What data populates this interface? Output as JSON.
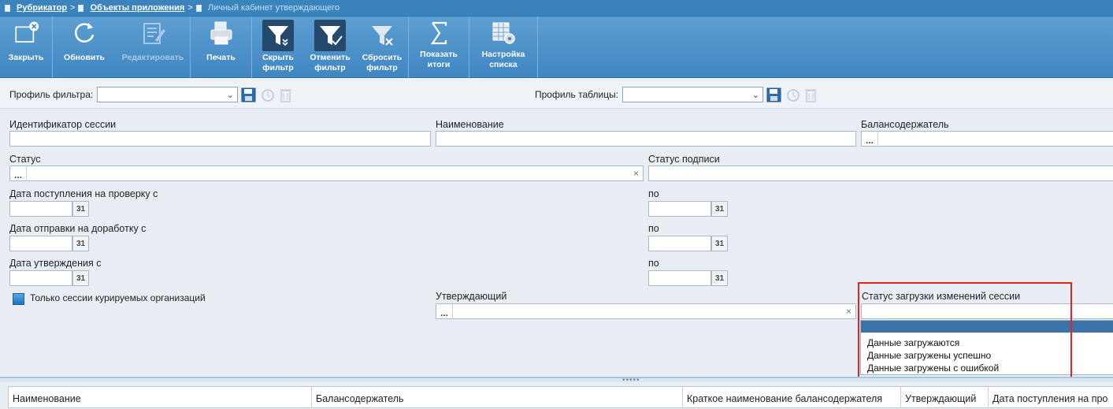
{
  "breadcrumb": {
    "items": [
      "Рубрикатор",
      "Объекты приложения"
    ],
    "separator": ">",
    "current": "Личный кабинет утверждающего"
  },
  "toolbar": {
    "close": "Закрыть",
    "refresh": "Обновить",
    "edit": "Редактировать",
    "print": "Печать",
    "hide_filter": [
      "Скрыть",
      "фильтр"
    ],
    "cancel_filter": [
      "Отменить",
      "фильтр"
    ],
    "reset_filter": [
      "Сбросить",
      "фильтр"
    ],
    "show_totals": [
      "Показать",
      "итоги"
    ],
    "list_settings": [
      "Настройка",
      "списка"
    ]
  },
  "profiles": {
    "filter_profile_label": "Профиль фильтра:",
    "filter_profile_value": "",
    "table_profile_label": "Профиль таблицы:",
    "table_profile_value": ""
  },
  "filter": {
    "session_id_label": "Идентификатор сессии",
    "session_id_value": "",
    "name_label": "Наименование",
    "name_value": "",
    "holder_label": "Балансодержатель",
    "status_label": "Статус",
    "sign_status_label": "Статус подписи",
    "received_from_label": "Дата поступления на проверку с",
    "sent_back_from_label": "Дата отправки на доработку с",
    "approved_from_label": "Дата утверждения с",
    "to_label": "по",
    "calendar_label": "31",
    "ellipsis": "...",
    "clear_glyph": "×",
    "only_curated_label": "Только сессии курируемых организаций",
    "approver_label": "Утверждающий",
    "load_status_label": "Статус загрузки изменений сессии",
    "load_status_options": [
      "",
      "Данные загружаются",
      "Данные загружены успешно",
      "Данные загружены с ошибкой"
    ]
  },
  "grid": {
    "columns": [
      "Наименование",
      "Балансодержатель",
      "Краткое наименование балансодержателя",
      "Утверждающий",
      "Дата поступления на про"
    ]
  },
  "colors": {
    "header_blue": "#3f86c2",
    "highlight": "#e52222"
  }
}
